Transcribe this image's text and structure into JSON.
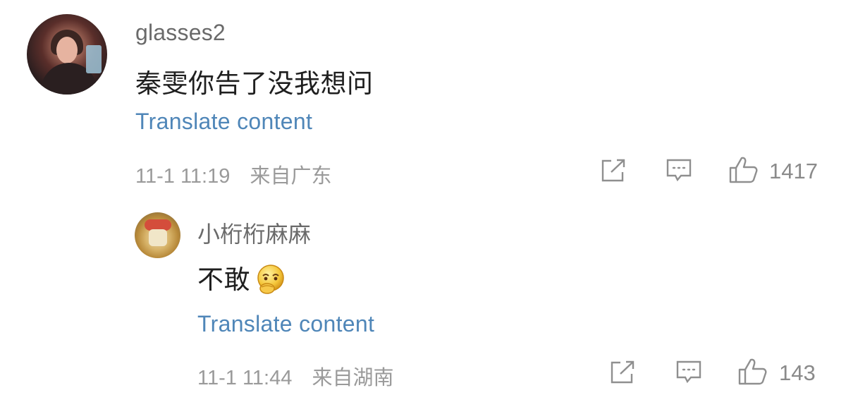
{
  "comment": {
    "username": "glasses2",
    "text": "秦雯你告了没我想问",
    "translate_label": "Translate content",
    "time": "11-1 11:19",
    "location": "来自广东",
    "like_count": "1417",
    "icons": {
      "share": "share-icon",
      "reply": "comment-icon",
      "like": "thumbs-up-icon"
    }
  },
  "reply": {
    "username": "小桁桁麻麻",
    "text": "不敢",
    "emoji": "covering-mouth-emoji",
    "translate_label": "Translate content",
    "time": "11-1 11:44",
    "location": "来自湖南",
    "like_count": "143",
    "icons": {
      "share": "share-icon",
      "reply": "comment-icon",
      "like": "thumbs-up-icon"
    }
  },
  "colors": {
    "link": "#4f86b8",
    "username": "#6a6a6a",
    "meta": "#9a9a9a",
    "text": "#1f1f1f"
  }
}
